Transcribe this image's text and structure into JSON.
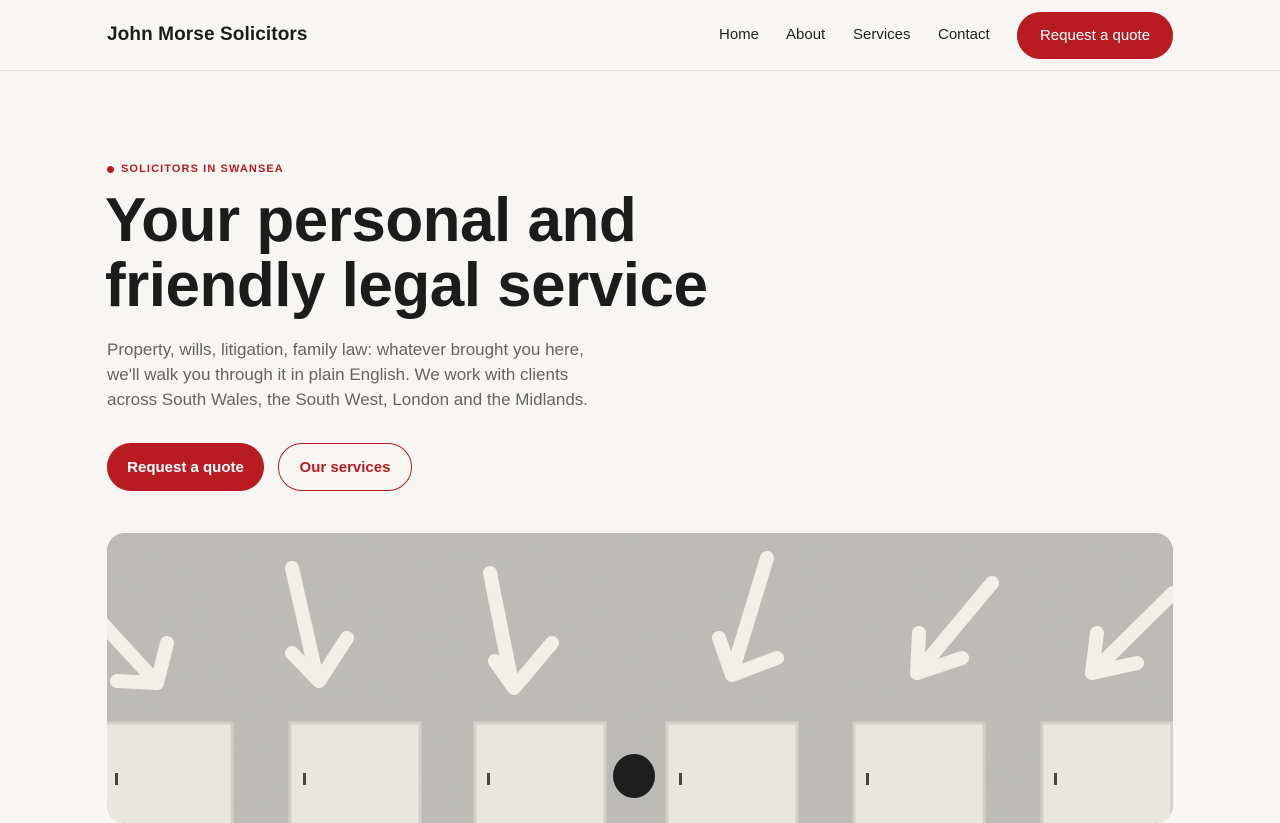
{
  "header": {
    "brand": "John Morse Solicitors",
    "nav": [
      "Home",
      "About",
      "Services",
      "Contact"
    ],
    "cta_label": "Request a quote"
  },
  "hero": {
    "eyebrow": "SOLICITORS IN SWANSEA",
    "title_line1": "Your personal and",
    "title_line2": "friendly legal service",
    "lede_line1": "Property, wills, litigation, family law: whatever brought you here,",
    "lede_line2": "we'll walk you through it in plain English. We work with clients",
    "lede_line3": "across South Wales, the South West, London and the Midlands.",
    "primary_cta": "Request a quote",
    "secondary_cta": "Our services"
  },
  "image": {
    "description_icon": "doors-arrows-photo"
  },
  "colors": {
    "accent": "#b81c22",
    "background": "#f7f6f3",
    "text": "#1c1c1c",
    "muted": "#666461"
  }
}
